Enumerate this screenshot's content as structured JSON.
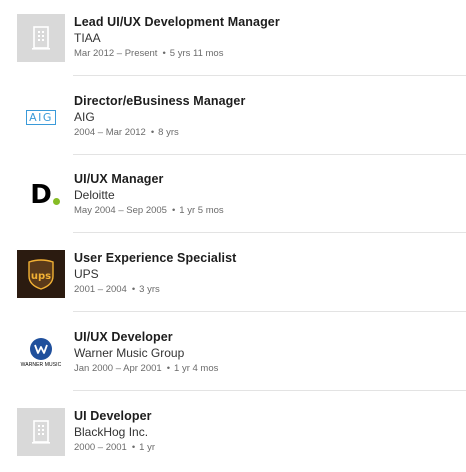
{
  "positions": [
    {
      "title": "Lead UI/UX Development Manager",
      "company": "TIAA",
      "date_range": "Mar 2012 – Present",
      "duration": "5 yrs 11 mos",
      "logo": "building-placeholder-icon"
    },
    {
      "title": "Director/eBusiness Manager",
      "company": "AIG",
      "date_range": "2004 – Mar 2012",
      "duration": "8 yrs",
      "logo": "aig-logo",
      "logo_text": "AIG"
    },
    {
      "title": "UI/UX Manager",
      "company": "Deloitte",
      "date_range": "May 2004 – Sep 2005",
      "duration": "1 yr 5 mos",
      "logo": "deloitte-logo",
      "logo_text": "D"
    },
    {
      "title": "User Experience Specialist",
      "company": "UPS",
      "date_range": "2001 – 2004",
      "duration": "3 yrs",
      "logo": "ups-logo",
      "logo_text": "ups"
    },
    {
      "title": "UI/UX Developer",
      "company": "Warner Music Group",
      "date_range": "Jan 2000 – Apr 2001",
      "duration": "1 yr 4 mos",
      "logo": "warner-music-logo",
      "logo_text": "WARNER MUSIC"
    },
    {
      "title": "UI Developer",
      "company": "BlackHog Inc.",
      "date_range": "2000 – 2001",
      "duration": "1 yr",
      "logo": "building-placeholder-icon"
    }
  ],
  "separator": "•",
  "colors": {
    "aig_blue": "#3a9ad9",
    "deloitte_green": "#86bc25",
    "ups_brown": "#2b1b10",
    "ups_gold": "#f2b134",
    "warner_blue": "#1f4f9c",
    "placeholder_gray": "#d9d9d9"
  }
}
